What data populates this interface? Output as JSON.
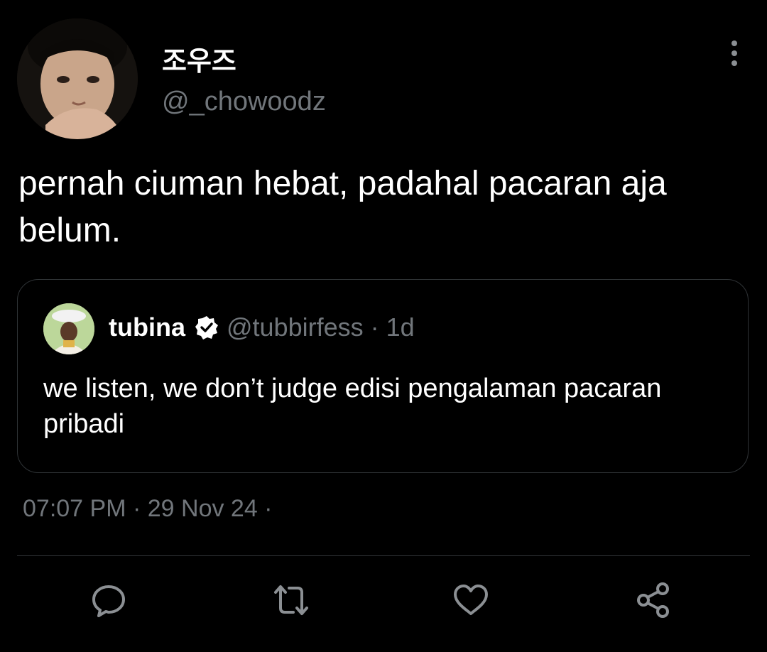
{
  "author": {
    "display_name": "조우즈",
    "handle": "@_chowoodz",
    "avatar": "avatar-photo"
  },
  "tweet": {
    "text": "pernah ciuman hebat, padahal pacaran aja belum."
  },
  "quoted_tweet": {
    "display_name": "tubina",
    "handle": "@tubbirfess",
    "age": "1d",
    "meta_separator": " · ",
    "text": "we listen, we don’t judge edisi pengalaman pacaran pribadi",
    "verified": true
  },
  "timestamp": {
    "text": "07:07 PM · 29 Nov 24 ·"
  },
  "actions": [
    {
      "name": "reply",
      "icon": "reply-icon"
    },
    {
      "name": "retweet",
      "icon": "retweet-icon"
    },
    {
      "name": "like",
      "icon": "heart-icon"
    },
    {
      "name": "share",
      "icon": "share-icon"
    }
  ],
  "colors": {
    "background": "#000000",
    "text_primary": "#ffffff",
    "text_secondary": "#71767b",
    "border": "#2f3336"
  }
}
